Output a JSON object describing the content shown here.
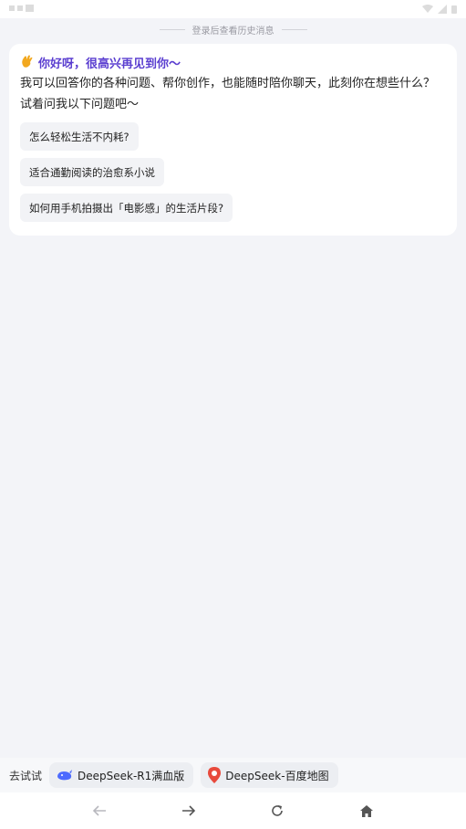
{
  "history_hint": "登录后查看历史消息",
  "welcome": {
    "wave_icon": "waving-hand-icon",
    "greeting": "你好呀，很高兴再见到你～",
    "intro": "我可以回答你的各种问题、帮你创作，也能随时陪你聊天，此刻你在想些什么？试着问我以下问题吧～"
  },
  "suggestions": [
    "怎么轻松生活不内耗?",
    "适合通勤阅读的治愈系小说",
    "如何用手机拍摄出「电影感」的生活片段?"
  ],
  "bottom": {
    "try_label": "去试试",
    "models": [
      {
        "label": "DeepSeek-R1满血版",
        "icon": "whale-icon"
      },
      {
        "label": "DeepSeek-百度地图",
        "icon": "map-pin-icon"
      }
    ]
  },
  "nav": {
    "back_icon": "arrow-left-icon",
    "forward_icon": "arrow-right-icon",
    "refresh_icon": "refresh-icon",
    "home_icon": "home-icon"
  },
  "colors": {
    "accent": "#5b3fd0",
    "background": "#f3f4f8",
    "card": "#ffffff",
    "chip": "#f2f3f6"
  }
}
